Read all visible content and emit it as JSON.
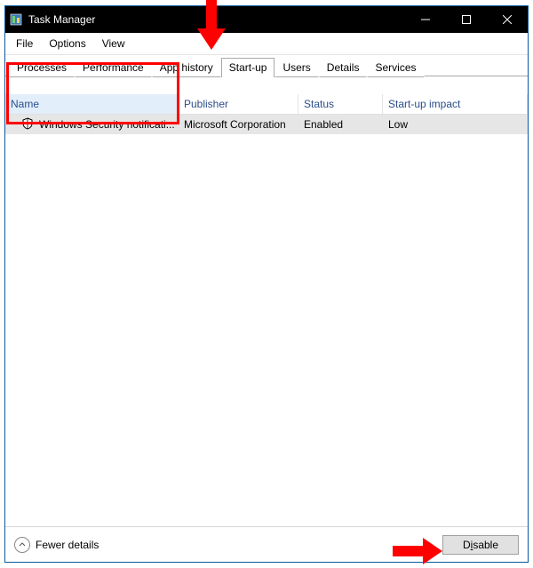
{
  "window": {
    "title": "Task Manager"
  },
  "menu": {
    "file": "File",
    "options": "Options",
    "view": "View"
  },
  "tabs": {
    "processes": "Processes",
    "performance": "Performance",
    "apphistory": "App history",
    "startup": "Start-up",
    "users": "Users",
    "details": "Details",
    "services": "Services"
  },
  "columns": {
    "name": "Name",
    "publisher": "Publisher",
    "status": "Status",
    "impact": "Start-up impact"
  },
  "rows": [
    {
      "icon": "shield-icon",
      "name": "Windows Security notificati...",
      "publisher": "Microsoft Corporation",
      "status": "Enabled",
      "impact": "Low"
    }
  ],
  "footer": {
    "fewer": "Fewer details",
    "disable_prefix": "D",
    "disable_ul": "i",
    "disable_suffix": "sable"
  }
}
